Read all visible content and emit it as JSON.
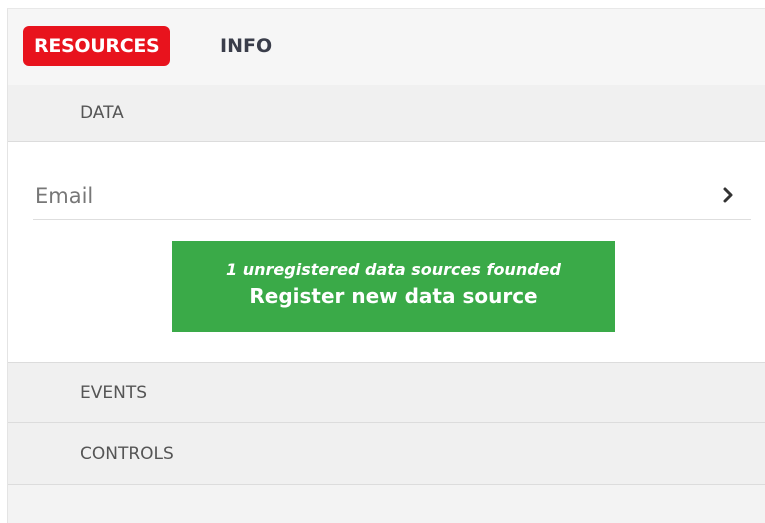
{
  "tabs": [
    {
      "label": "RESOURCES",
      "active": true
    },
    {
      "label": "INFO",
      "active": false
    }
  ],
  "sections": {
    "data": {
      "label": "DATA",
      "resources": [
        {
          "label": "Email",
          "icon": "chevron-right-icon"
        }
      ],
      "register": {
        "note": "1 unregistered data sources founded",
        "label": "Register new data source"
      }
    },
    "events": {
      "label": "EVENTS"
    },
    "controls": {
      "label": "CONTROLS"
    }
  },
  "colors": {
    "active_tab": "#e8131d",
    "register_button": "#3aaa48",
    "panel_background": "#f3f3f3"
  }
}
